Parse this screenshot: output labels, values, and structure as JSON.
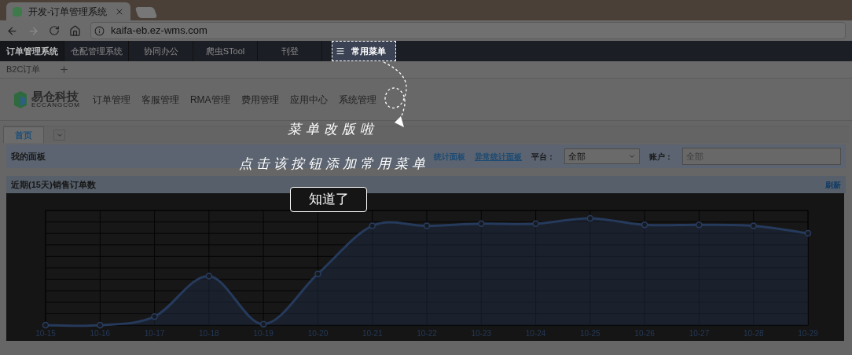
{
  "browser": {
    "tab_title": "开发-订单管理系统",
    "url": "kaifa-eb.ez-wms.com"
  },
  "top_nav": [
    {
      "label": "订单管理系统",
      "selected": true
    },
    {
      "label": "仓配管理系统",
      "selected": false
    },
    {
      "label": "协同办公",
      "selected": false
    },
    {
      "label": "爬虫STool",
      "selected": false
    },
    {
      "label": "刊登",
      "selected": false
    }
  ],
  "menu_button": {
    "label": "常用菜单"
  },
  "sub_tabs": [
    {
      "label": "B2C订单"
    }
  ],
  "logo": {
    "name": "易仓科技",
    "subtitle": "ECCANGCOM"
  },
  "main_menu": [
    "订单管理",
    "客服管理",
    "RMA管理",
    "费用管理",
    "应用中心",
    "系统管理"
  ],
  "page_tabs": [
    {
      "label": "首页",
      "selected": true
    }
  ],
  "panel": {
    "title": "我的面板",
    "links": [
      "统计面板",
      "异常统计面板"
    ],
    "platform_label": "平台：",
    "platform_value": "全部",
    "account_label": "账户：",
    "account_placeholder": "全部"
  },
  "chart_panel": {
    "title": "近期(15天)销售订单数",
    "refresh": "刷新",
    "x_labels": [
      "10-15",
      "10-16",
      "10-17",
      "10-18",
      "10-19",
      "10-20",
      "10-21",
      "10-22",
      "10-23",
      "10-24",
      "10-25",
      "10-26",
      "10-27",
      "10-28",
      "10-29"
    ]
  },
  "guide": {
    "caption": "菜单改版啦",
    "hint": "点击该按钮添加常用菜单",
    "button": "知道了"
  }
}
